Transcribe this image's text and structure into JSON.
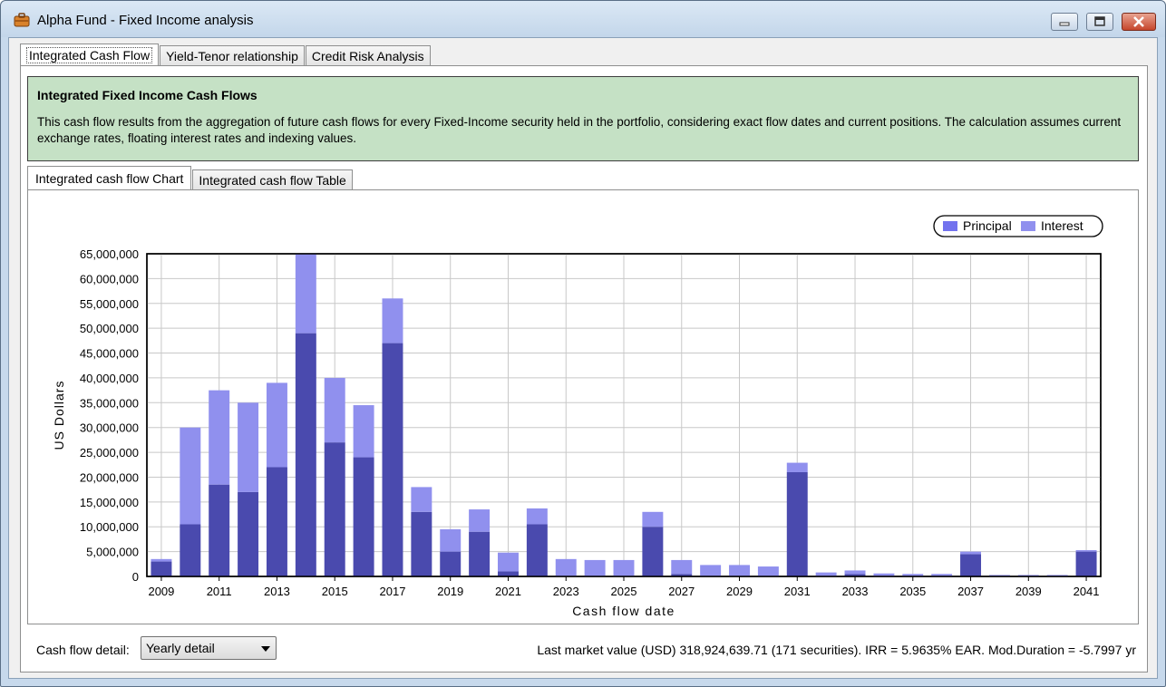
{
  "window": {
    "title": "Alpha Fund - Fixed Income analysis"
  },
  "tabs": [
    "Integrated Cash Flow",
    "Yield-Tenor relationship",
    "Credit Risk Analysis"
  ],
  "info": {
    "title": "Integrated Fixed Income Cash Flows",
    "description": "This cash flow results from the aggregation of future cash flows for every Fixed-Income security held in the portfolio, considering exact flow dates and current positions. The calculation assumes current exchange rates, floating interest rates and indexing values."
  },
  "inner_tabs": [
    "Integrated cash flow Chart",
    "Integrated cash flow Table"
  ],
  "bottom": {
    "detail_label": "Cash flow detail:",
    "detail_value": "Yearly detail",
    "status": "Last market value (USD) 318,924,639.71 (171 securities). IRR = 5.9635% EAR. Mod.Duration = -5.7997 yr"
  },
  "colors": {
    "principal": "#4a4aae",
    "interest": "#9090ee",
    "legend_principal": "#7272ee",
    "info_bg": "#c5e1c5"
  },
  "chart_data": {
    "type": "bar",
    "stacked": true,
    "xlabel": "Cash flow date",
    "ylabel": "US Dollars",
    "ylim": [
      0,
      65000000
    ],
    "y_ticks": [
      "0",
      "5,000,000",
      "10,000,000",
      "15,000,000",
      "20,000,000",
      "25,000,000",
      "30,000,000",
      "35,000,000",
      "40,000,000",
      "45,000,000",
      "50,000,000",
      "55,000,000",
      "60,000,000",
      "65,000,000"
    ],
    "x_tick_labels": [
      "2009",
      "2011",
      "2013",
      "2015",
      "2017",
      "2019",
      "2021",
      "2023",
      "2025",
      "2027",
      "2029",
      "2031",
      "2033",
      "2035",
      "2037",
      "2039",
      "2041"
    ],
    "categories": [
      "2009",
      "2010",
      "2011",
      "2012",
      "2013",
      "2014",
      "2015",
      "2016",
      "2017",
      "2018",
      "2019",
      "2020",
      "2021",
      "2022",
      "2023",
      "2024",
      "2025",
      "2026",
      "2027",
      "2028",
      "2029",
      "2030",
      "2031",
      "2032",
      "2033",
      "2034",
      "2035",
      "2036",
      "2037",
      "2038",
      "2039",
      "2040",
      "2041"
    ],
    "legend_position": "top-right",
    "grid": true,
    "series": [
      {
        "name": "Principal",
        "values": [
          3000000,
          10500000,
          18500000,
          17000000,
          22000000,
          49000000,
          27000000,
          24000000,
          47000000,
          13000000,
          5000000,
          9000000,
          1000000,
          10500000,
          0,
          0,
          0,
          10000000,
          500000,
          0,
          0,
          0,
          21000000,
          0,
          500000,
          0,
          0,
          0,
          4500000,
          0,
          0,
          0,
          5000000
        ]
      },
      {
        "name": "Interest",
        "values": [
          500000,
          19500000,
          19000000,
          18000000,
          17000000,
          16000000,
          13000000,
          10500000,
          9000000,
          5000000,
          4500000,
          4500000,
          3800000,
          3200000,
          3500000,
          3300000,
          3300000,
          3000000,
          2800000,
          2300000,
          2300000,
          2000000,
          1900000,
          800000,
          700000,
          600000,
          500000,
          500000,
          500000,
          300000,
          300000,
          300000,
          300000
        ]
      }
    ]
  }
}
